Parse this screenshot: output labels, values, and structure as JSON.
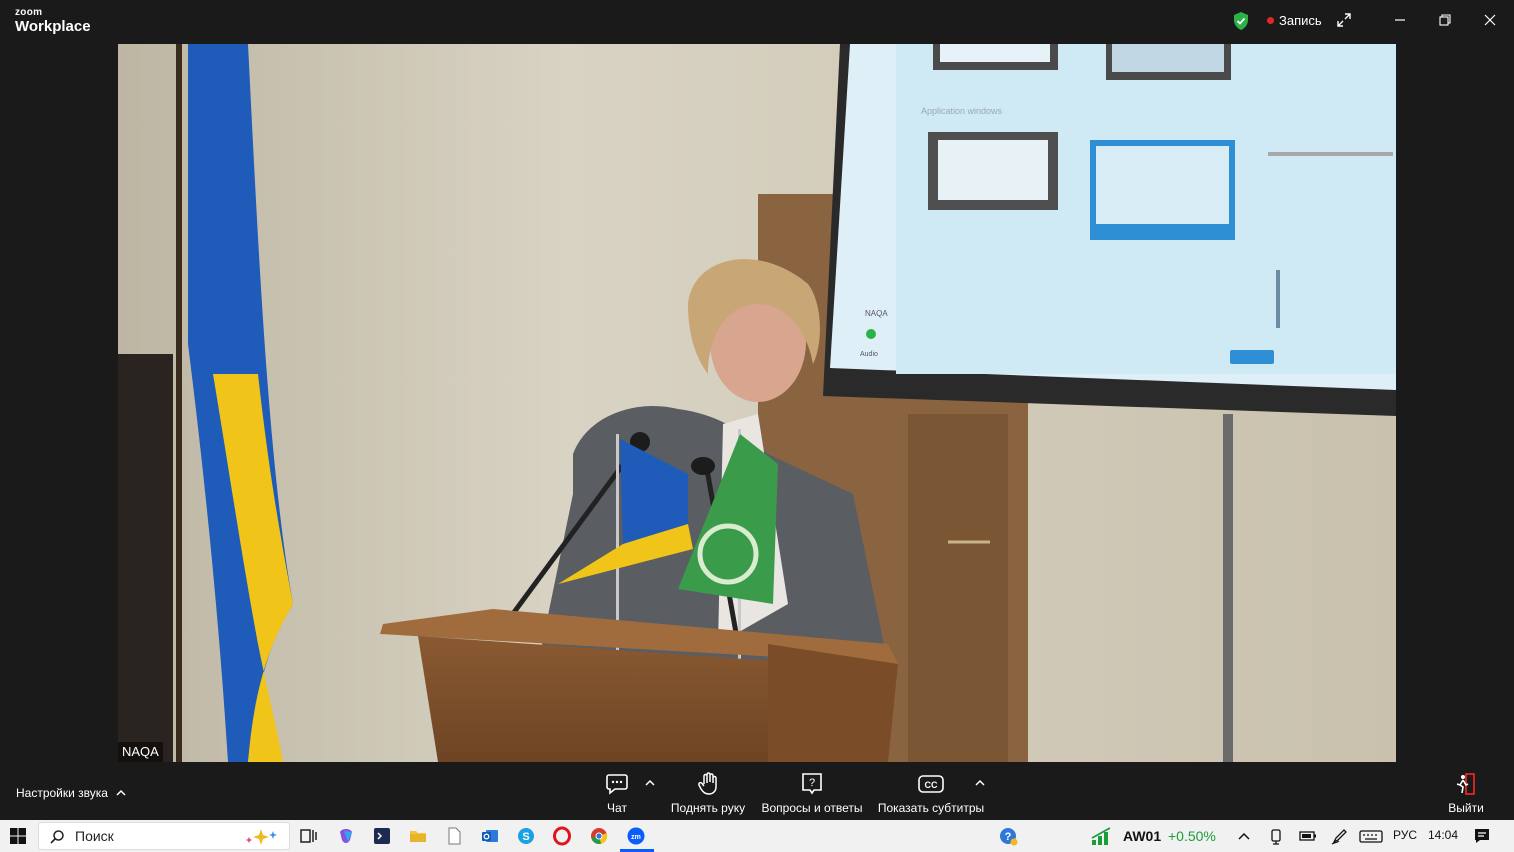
{
  "app": {
    "logo_line1": "zoom",
    "logo_line2": "Workplace"
  },
  "titlebar": {
    "recording_label": "Запись"
  },
  "video": {
    "participant_name": "NAQA",
    "screen_texts": {
      "section": "Application windows",
      "badge": "NAQA",
      "audio": "Audio"
    }
  },
  "toolbar": {
    "audio_settings_label": "Настройки звука",
    "chat_label": "Чат",
    "raise_hand_label": "Поднять руку",
    "qa_label": "Вопросы и ответы",
    "captions_label": "Показать субтитры",
    "leave_label": "Выйти"
  },
  "taskbar": {
    "search_placeholder": "Поиск",
    "stock_ticker": "AW01",
    "stock_change": "+0.50%",
    "language": "РУС",
    "time": "14:04"
  },
  "colors": {
    "accent_zoom": "#0b5cff",
    "record_red": "#e02828",
    "shield_green": "#2bb14a",
    "stock_green": "#1a9e3a"
  }
}
